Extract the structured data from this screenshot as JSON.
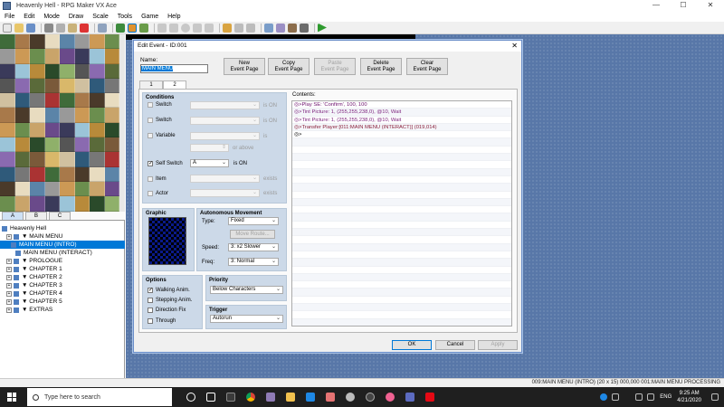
{
  "window": {
    "title": "Heavenly Hell - RPG Maker VX Ace",
    "controls": [
      "—",
      "☐",
      "✕"
    ]
  },
  "menu": [
    "File",
    "Edit",
    "Mode",
    "Draw",
    "Scale",
    "Tools",
    "Game",
    "Help"
  ],
  "tile_tabs": [
    "A",
    "B",
    "C"
  ],
  "tree": [
    {
      "label": "Heavenly Hell",
      "indent": 0,
      "selected": false
    },
    {
      "label": "▼ MAIN MENU",
      "indent": 1,
      "selected": false
    },
    {
      "label": "MAIN MENU (INTRO)",
      "indent": 2,
      "selected": true
    },
    {
      "label": "MAIN MENU (INTERACT)",
      "indent": 3,
      "selected": false
    },
    {
      "label": "▼ PROLOGUE",
      "indent": 1,
      "selected": false
    },
    {
      "label": "▼ CHAPTER 1",
      "indent": 1,
      "selected": false
    },
    {
      "label": "▼ CHAPTER 2",
      "indent": 1,
      "selected": false
    },
    {
      "label": "▼ CHAPTER 3",
      "indent": 1,
      "selected": false
    },
    {
      "label": "▼ CHAPTER 4",
      "indent": 1,
      "selected": false
    },
    {
      "label": "▼ CHAPTER 5",
      "indent": 1,
      "selected": false
    },
    {
      "label": "▼ EXTRAS",
      "indent": 1,
      "selected": false
    }
  ],
  "dialog": {
    "title": "Edit Event - ID:001",
    "close": "✕",
    "name_label": "Name:",
    "name_value": "MAIN MENU PROCESSING",
    "buttons": {
      "new": [
        "New",
        "Event Page"
      ],
      "copy": [
        "Copy",
        "Event Page"
      ],
      "paste": [
        "Paste",
        "Event Page"
      ],
      "delete": [
        "Delete",
        "Event Page"
      ],
      "clear": [
        "Clear",
        "Event Page"
      ]
    },
    "tabs": [
      "1",
      "2"
    ],
    "conditions": {
      "title": "Conditions",
      "switch1": "Switch",
      "switch2": "Switch",
      "variable": "Variable",
      "self_switch": "Self Switch",
      "self_switch_value": "A",
      "item": "Item",
      "actor": "Actor",
      "is_on": "is ON",
      "or_above": "or above",
      "exists": "exists",
      "is_on_self": "is ON"
    },
    "graphic_title": "Graphic",
    "movement": {
      "title": "Autonomous Movement",
      "type_label": "Type:",
      "type_value": "Fixed",
      "move_route": "Move Route...",
      "speed_label": "Speed:",
      "speed_value": "3: x2 Slower",
      "freq_label": "Freq:",
      "freq_value": "3: Normal"
    },
    "options": {
      "title": "Options",
      "walking": "Walking Anim.",
      "stepping": "Stepping Anim.",
      "direction_fix": "Direction Fix",
      "through": "Through"
    },
    "priority": {
      "title": "Priority",
      "value": "Below Characters"
    },
    "trigger": {
      "title": "Trigger",
      "value": "Autorun"
    },
    "contents_label": "Contents:",
    "contents": [
      "◎>Play SE: 'Confirm', 100, 100",
      "◎>Tint Picture: 1, (255,255,238,0), @10, Wait",
      "◎>Tint Picture: 1, (255,255,238,0), @10, Wait",
      "◎>Transfer Player:[011:MAIN MENU (INTERACT)] (019,014)",
      "◎>"
    ],
    "ok": "OK",
    "cancel": "Cancel",
    "apply": "Apply"
  },
  "status": "009:MAIN MENU (INTRO) (20 x 15)   000,000   001:MAIN MENU PROCESSING",
  "taskbar": {
    "search_placeholder": "Type here to search",
    "time": "9:25 AM",
    "date": "4/21/2020",
    "lang": "ENG"
  },
  "colors": {
    "accent": "#0078d7",
    "map_bg": "#5877a8",
    "group_bg": "#ccd9e8"
  }
}
